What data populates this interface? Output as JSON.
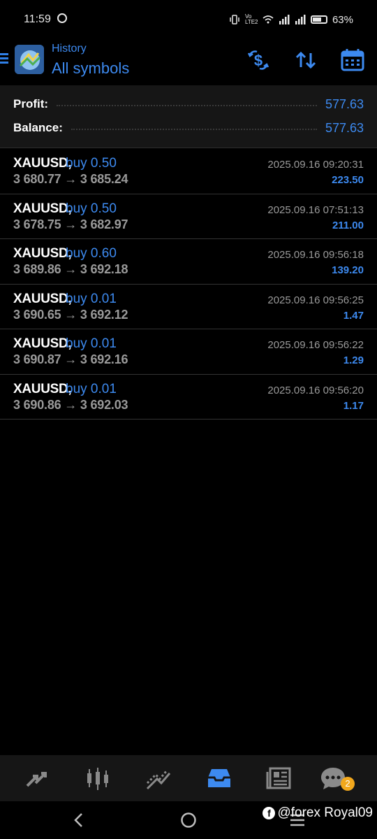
{
  "status_bar": {
    "time": "11:59",
    "battery": "63%",
    "net_label": "Vo LTE2"
  },
  "header": {
    "subtitle": "History",
    "title": "All symbols",
    "icons": [
      "menu-icon",
      "app-logo",
      "currency-exchange-icon",
      "sort-icon",
      "calendar-icon"
    ]
  },
  "summary": {
    "profit_label": "Profit:",
    "profit_value": "577.63",
    "balance_label": "Balance:",
    "balance_value": "577.63"
  },
  "deals": [
    {
      "symbol": "XAUUSD,",
      "type": "buy 0.50",
      "prices": "3 680.77 → 3 685.24",
      "time": "2025.09.16 09:20:31",
      "profit": "223.50"
    },
    {
      "symbol": "XAUUSD,",
      "type": "buy 0.50",
      "prices": "3 678.75 → 3 682.97",
      "time": "2025.09.16 07:51:13",
      "profit": "211.00"
    },
    {
      "symbol": "XAUUSD,",
      "type": "buy 0.60",
      "prices": "3 689.86 → 3 692.18",
      "time": "2025.09.16 09:56:18",
      "profit": "139.20"
    },
    {
      "symbol": "XAUUSD,",
      "type": "buy 0.01",
      "prices": "3 690.65 → 3 692.12",
      "time": "2025.09.16 09:56:25",
      "profit": "1.47"
    },
    {
      "symbol": "XAUUSD,",
      "type": "buy 0.01",
      "prices": "3 690.87 → 3 692.16",
      "time": "2025.09.16 09:56:22",
      "profit": "1.29"
    },
    {
      "symbol": "XAUUSD,",
      "type": "buy 0.01",
      "prices": "3 690.86 → 3 692.03",
      "time": "2025.09.16 09:56:20",
      "profit": "1.17"
    }
  ],
  "bottom_nav": {
    "items": [
      "quotes-icon",
      "chart-icon",
      "trade-icon",
      "history-icon",
      "news-icon",
      "chat-icon"
    ],
    "chat_badge": "2"
  },
  "watermark": "@forex Royal09",
  "colors": {
    "accent": "#3d8af0",
    "background": "#000000",
    "panel": "#161616",
    "muted_text": "#9a9a9a",
    "badge": "#f2a81d"
  }
}
